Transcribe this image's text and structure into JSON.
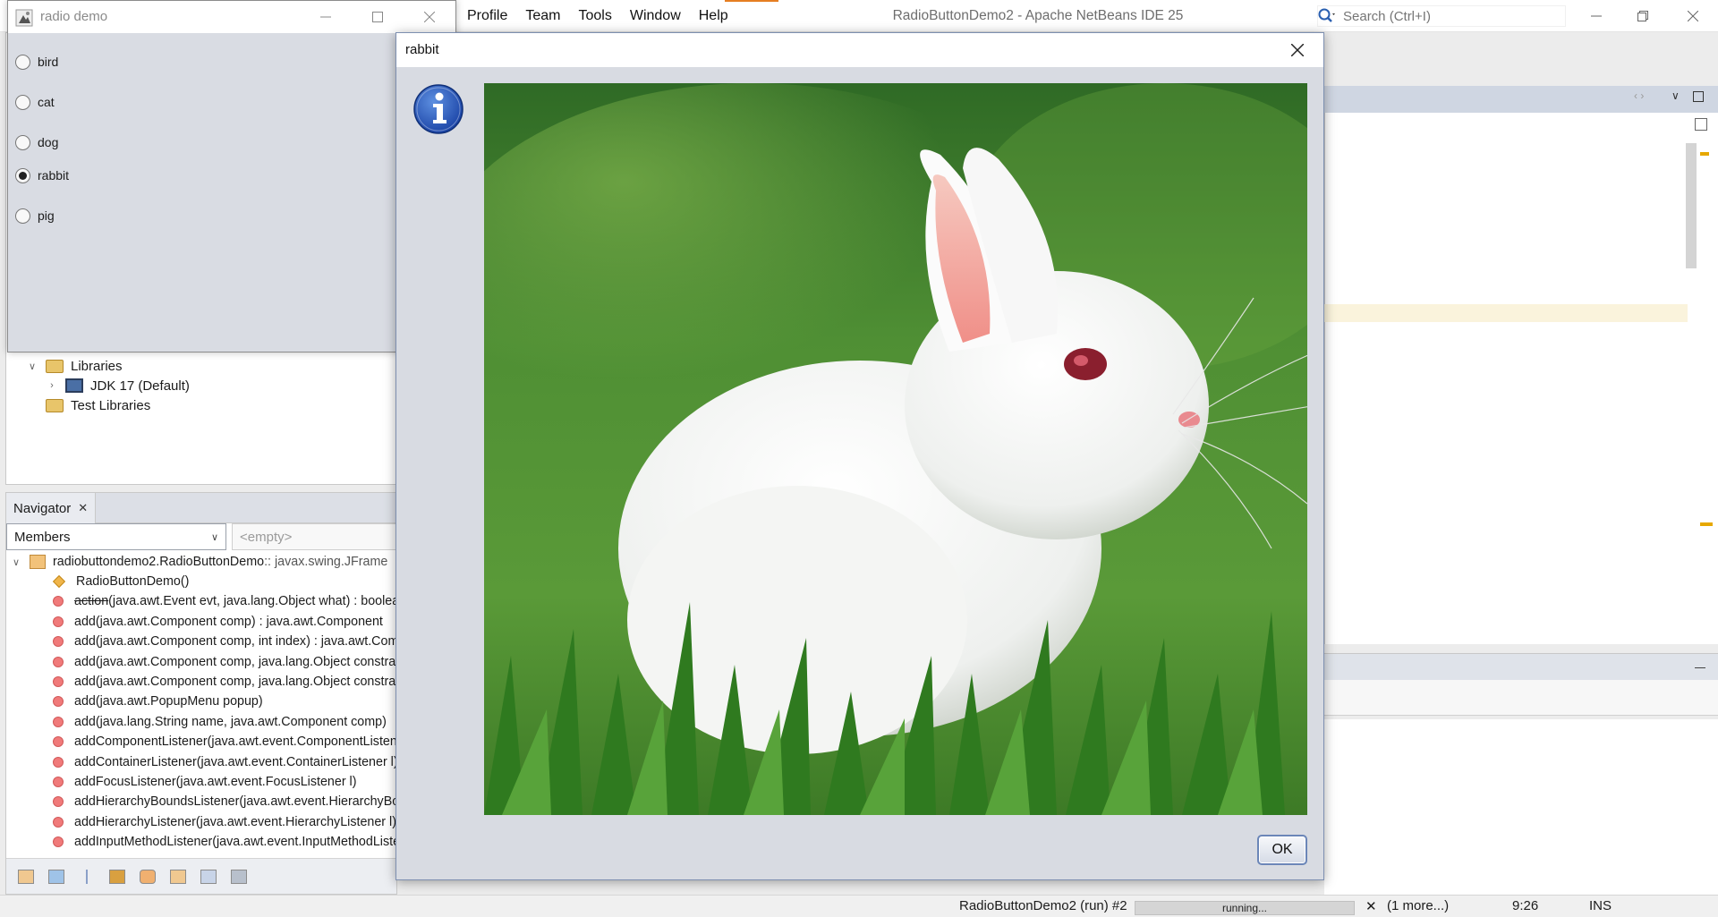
{
  "ide": {
    "title": "RadioButtonDemo2 - Apache NetBeans IDE 25",
    "menu": [
      "Profile",
      "Team",
      "Tools",
      "Window",
      "Help"
    ],
    "search_placeholder": "Search (Ctrl+I)",
    "projects_tree": [
      {
        "label": "Libraries",
        "icon": "folder-icon",
        "expanded": true
      },
      {
        "label": "JDK 17 (Default)",
        "icon": "jdk-icon"
      },
      {
        "label": "Test Libraries",
        "icon": "folder-icon"
      }
    ],
    "navigator": {
      "tab_label": "Navigator",
      "members_select": "Members",
      "empty_select": "<empty>",
      "root_class": "radiobuttondemo2.RadioButtonDemo",
      "root_class_super": " :: javax.swing.JFrame",
      "members": [
        {
          "name": "RadioButtonDemo()",
          "kind": "constructor"
        },
        {
          "name": "action",
          "rest": "(java.awt.Event evt, java.lang.Object what) : boolean",
          "deprecated": true
        },
        {
          "name": "add",
          "rest": "(java.awt.Component comp) : java.awt.Component"
        },
        {
          "name": "add",
          "rest": "(java.awt.Component comp, int index) : java.awt.Component"
        },
        {
          "name": "add",
          "rest": "(java.awt.Component comp, java.lang.Object constraints)"
        },
        {
          "name": "add",
          "rest": "(java.awt.Component comp, java.lang.Object constraints, int index)"
        },
        {
          "name": "add",
          "rest": "(java.awt.PopupMenu popup)"
        },
        {
          "name": "add",
          "rest": "(java.lang.String name, java.awt.Component comp)"
        },
        {
          "name": "addComponentListener",
          "rest": "(java.awt.event.ComponentListener l)"
        },
        {
          "name": "addContainerListener",
          "rest": "(java.awt.event.ContainerListener l)"
        },
        {
          "name": "addFocusListener",
          "rest": "(java.awt.event.FocusListener l)"
        },
        {
          "name": "addHierarchyBoundsListener",
          "rest": "(java.awt.event.HierarchyBoundsListener l)"
        },
        {
          "name": "addHierarchyListener",
          "rest": "(java.awt.event.HierarchyListener l)"
        },
        {
          "name": "addInputMethodListener",
          "rest": "(java.awt.event.InputMethodListener l)"
        }
      ]
    },
    "status": {
      "run": "RadioButtonDemo2 (run) #2",
      "progress": "running...",
      "more": "(1 more...)",
      "position": "9:26",
      "mode": "INS"
    }
  },
  "radio_window": {
    "title": "radio demo",
    "options": [
      {
        "label": "bird",
        "checked": false
      },
      {
        "label": "cat",
        "checked": false
      },
      {
        "label": "dog",
        "checked": false
      },
      {
        "label": "rabbit",
        "checked": true
      },
      {
        "label": "pig",
        "checked": false
      }
    ]
  },
  "dialog": {
    "title": "rabbit",
    "icon": "info-icon",
    "ok_label": "OK"
  }
}
